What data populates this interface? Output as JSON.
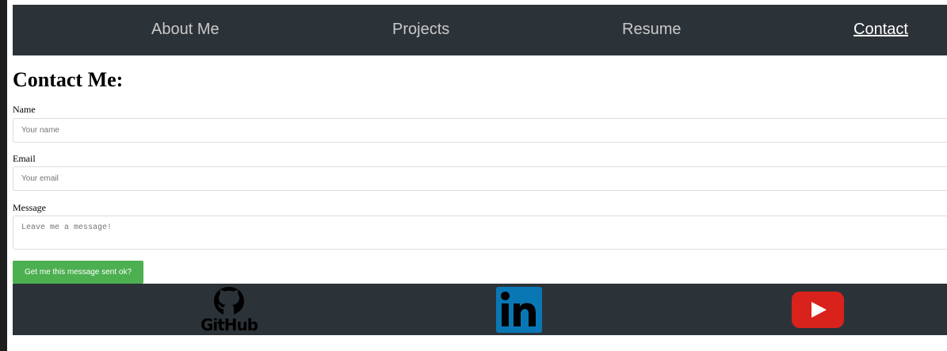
{
  "nav": {
    "items": [
      {
        "label": "About Me",
        "active": false
      },
      {
        "label": "Projects",
        "active": false
      },
      {
        "label": "Resume",
        "active": false
      },
      {
        "label": "Contact",
        "active": true
      }
    ]
  },
  "page": {
    "title": "Contact Me:"
  },
  "form": {
    "name_label": "Name",
    "name_placeholder": "Your name",
    "email_label": "Email",
    "email_placeholder": "Your email",
    "message_label": "Message",
    "message_placeholder": "Leave me a message!",
    "submit_label": "Get me this message sent ok?"
  },
  "footer": {
    "icons": [
      "github-icon",
      "linkedin-icon",
      "youtube-icon"
    ],
    "github_text": "GitHub"
  },
  "colors": {
    "nav_bg": "#2c3338",
    "submit_bg": "#4caf50",
    "linkedin": "#0a77b5",
    "youtube": "#d9221c"
  }
}
